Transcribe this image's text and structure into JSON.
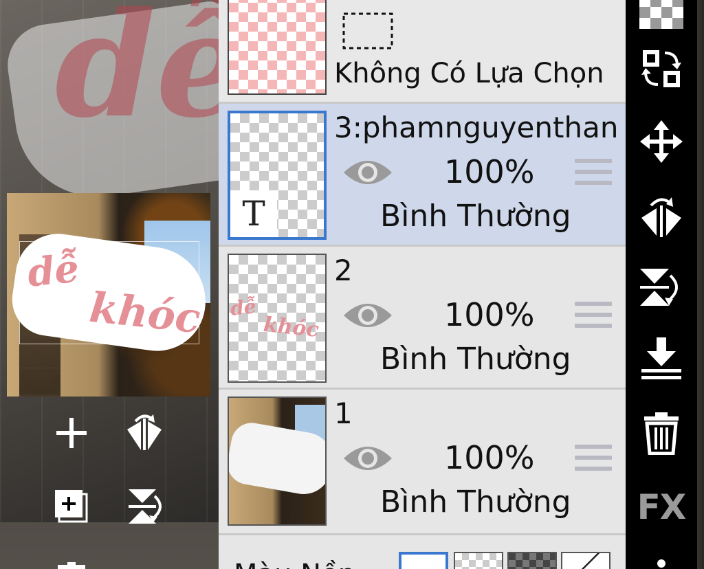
{
  "selection_row": {
    "label": "Không Có Lựa Chọn"
  },
  "layers": [
    {
      "name": "3:phamnguyenthan",
      "opacity": "100%",
      "blend_mode": "Bình Thường",
      "thumb_text_glyph": "T",
      "active": true
    },
    {
      "name": "2",
      "opacity": "100%",
      "blend_mode": "Bình Thường",
      "thumb_words": [
        "dễ",
        "khóc"
      ]
    },
    {
      "name": "1",
      "opacity": "100%",
      "blend_mode": "Bình Thường"
    }
  ],
  "background_row": {
    "label": "Màu Nền"
  },
  "preview": {
    "words": [
      "dễ",
      "khóc"
    ],
    "canvas_word": "dễ"
  },
  "left_tools": [
    "add-layer",
    "flip-horizontal",
    "add-layer-copy",
    "flip-vertical",
    "delete"
  ],
  "right_tools": [
    "transparent-bg",
    "swap-layers",
    "move",
    "flip-horizontal",
    "flip-vertical",
    "merge-down",
    "delete",
    "fx",
    "more"
  ],
  "right_toolbar": {
    "fx_label": "FX"
  },
  "colors": {
    "panel_bg": "#e6e6e6",
    "active_layer_bg": "#cfd8ea",
    "active_border": "#3a78d0",
    "accent_pink": "#e58f97"
  }
}
